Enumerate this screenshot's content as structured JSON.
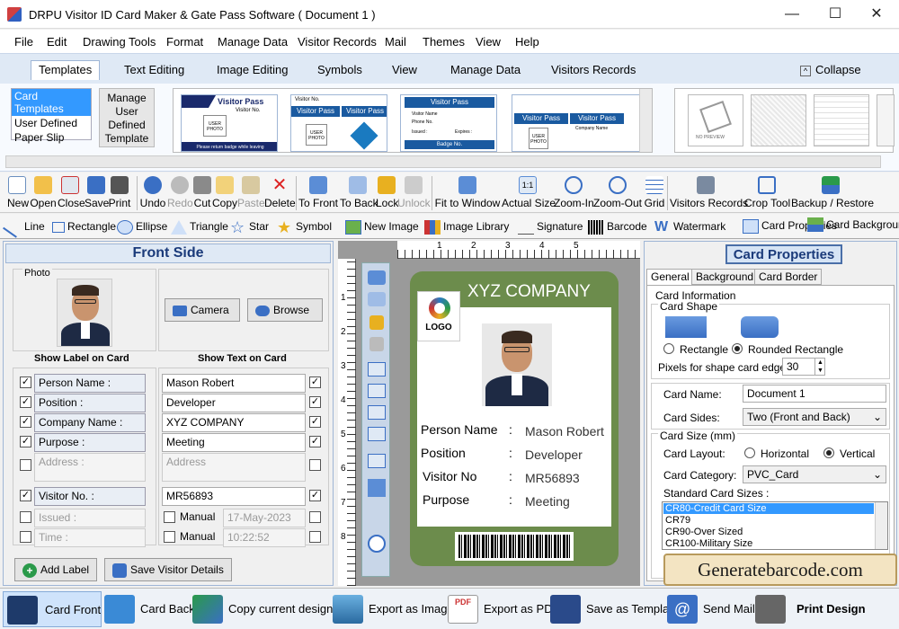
{
  "window": {
    "title": "DRPU Visitor ID Card Maker & Gate Pass Software ( Document 1 )",
    "minimize": "—",
    "maximize": "☐",
    "close": "✕"
  },
  "menu": [
    "File",
    "Edit",
    "Drawing Tools",
    "Format",
    "Manage Data",
    "Visitor Records",
    "Mail",
    "Themes",
    "View",
    "Help"
  ],
  "ribbon_tabs": [
    "Templates",
    "Text Editing",
    "Image Editing",
    "Symbols",
    "View",
    "Manage Data",
    "Visitors Records"
  ],
  "collapse": "Collapse",
  "template_list": [
    "Card Templates",
    "User Defined",
    "Paper Slip"
  ],
  "manage_template": "Manage User Defined Template",
  "thumbs": {
    "t1": {
      "title": "Visitor Pass",
      "sub": "Visitor No.",
      "photo": "USER PHOTO",
      "footer": "Please return badge while leaving"
    },
    "t2": {
      "a": "Visitor No.",
      "b": "Visitor Pass",
      "c": "Visitor Pass",
      "photo": "USER PHOTO"
    },
    "t3": {
      "title": "Visitor Pass",
      "f1": "Visitor Name",
      "f2": "Phone No.",
      "f3": "Issued :",
      "f4": "Expires :",
      "f5": "Badge No."
    },
    "t4": {
      "a": "Visitor Pass",
      "b": "Visitor Pass",
      "c": "Company Name",
      "photo": "USER PHOTO"
    },
    "bg1": "NO PREVIEW"
  },
  "toolbar": [
    "New",
    "Open",
    "Close",
    "Save",
    "Print",
    "Undo",
    "Redo",
    "Cut",
    "Copy",
    "Paste",
    "Delete",
    "To Front",
    "To Back",
    "Lock",
    "Unlock",
    "Fit to Window",
    "Actual Size",
    "Zoom-In",
    "Zoom-Out",
    "Grid",
    "Visitors Records",
    "Crop Tool",
    "Backup / Restore"
  ],
  "toolbar_icons": {
    "actual": "1:1"
  },
  "draw_tools": [
    "Line",
    "Rectangle",
    "Ellipse",
    "Triangle",
    "Star",
    "Symbol",
    "New Image",
    "Image Library",
    "Signature",
    "Barcode",
    "Watermark",
    "Card Properties",
    "Card Background"
  ],
  "front": {
    "header": "Front Side",
    "photo_label": "Photo",
    "camera": "Camera",
    "browse": "Browse",
    "show_label": "Show Label on Card",
    "show_text": "Show Text on Card",
    "rows": [
      {
        "label": "Person Name :",
        "value": "Mason Robert",
        "lc": true,
        "rc": true
      },
      {
        "label": "Position :",
        "value": "Developer",
        "lc": true,
        "rc": true
      },
      {
        "label": "Company Name :",
        "value": "XYZ COMPANY",
        "lc": true,
        "rc": true
      },
      {
        "label": "Purpose :",
        "value": "Meeting",
        "lc": true,
        "rc": true
      },
      {
        "label": "Address :",
        "value": "Address",
        "lc": false,
        "rc": false
      },
      {
        "label": "Visitor No. :",
        "value": "MR56893",
        "lc": true,
        "rc": true
      }
    ],
    "issued": "Issued :",
    "time": "Time :",
    "manual": "Manual",
    "date": "17-May-2023",
    "clock": "10:22:52",
    "add_label": "Add Label",
    "save_details": "Save Visitor Details"
  },
  "card": {
    "company": "XYZ COMPANY",
    "logo": "LOGO",
    "fields": [
      {
        "k": "Person Name",
        "v": "Mason Robert"
      },
      {
        "k": "Position",
        "v": "Developer"
      },
      {
        "k": "Visitor No",
        "v": "MR56893"
      },
      {
        "k": "Purpose",
        "v": "Meeting"
      }
    ],
    "colon": ":",
    "ruler_top": [
      "1",
      "2",
      "3",
      "4",
      "5"
    ],
    "ruler_left": [
      "1",
      "2",
      "3",
      "4",
      "5",
      "6",
      "7",
      "8"
    ]
  },
  "props": {
    "header": "Card Properties",
    "tabs": [
      "General",
      "Background",
      "Card Border"
    ],
    "info": "Card Information",
    "shape": "Card Shape",
    "rect": "Rectangle",
    "rounded": "Rounded Rectangle",
    "edge_label": "Pixels for shape card edge :",
    "edge": "30",
    "name_label": "Card Name:",
    "name": "Document 1",
    "sides_label": "Card Sides:",
    "sides": "Two (Front and Back)",
    "size": "Card Size (mm)",
    "layout_label": "Card Layout:",
    "horizontal": "Horizontal",
    "vertical": "Vertical",
    "category_label": "Card Category:",
    "category": "PVC_Card",
    "std": "Standard Card Sizes :",
    "sizes": [
      "CR80-Credit Card Size",
      "CR79",
      "CR90-Over Sized",
      "CR100-Military Size"
    ]
  },
  "watermark_banner": "Generatebarcode.com",
  "bottom": [
    "Card Front",
    "Card Back",
    "Copy current design",
    "Export as Image",
    "Export as PDF",
    "Save as Template",
    "Send Mail",
    "Print Design"
  ],
  "bottom_icons": {
    "pdf": "PDF"
  },
  "colors": {
    "accent": "#6c8c4c",
    "header": "#1a3a7a",
    "selected": "#3399ff"
  }
}
